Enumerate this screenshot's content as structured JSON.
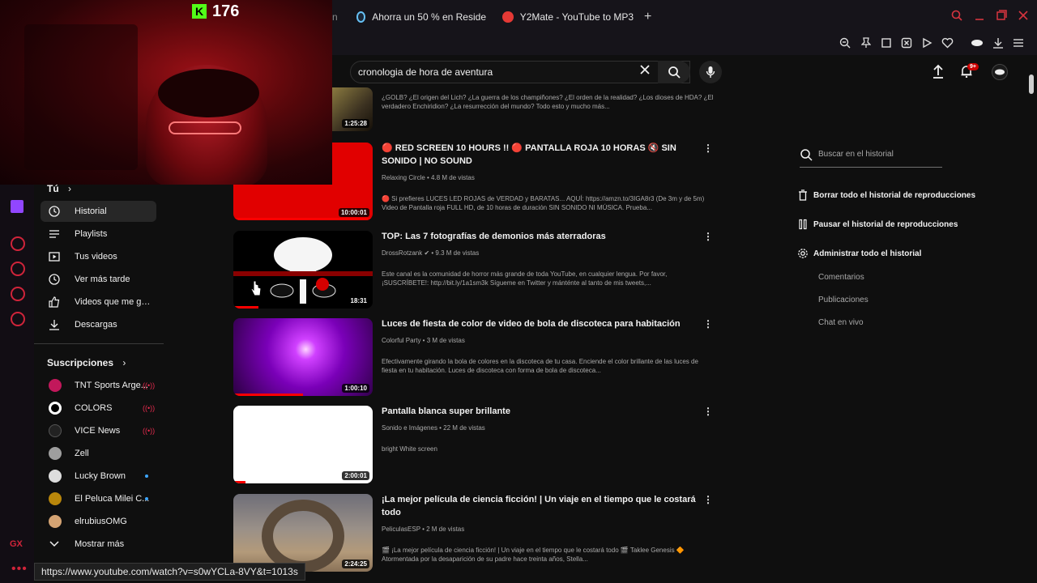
{
  "browser": {
    "tabs": [
      {
        "label": "n",
        "icon": "tab-icon"
      },
      {
        "label": "Ahorra un 50 % en Reside",
        "icon": "steam-icon"
      },
      {
        "label": "Y2Mate - YouTube to MP3",
        "icon": "y2mate-icon"
      }
    ],
    "new_tab": "+",
    "status_url": "https://www.youtube.com/watch?v=s0wYCLa-8VY&t=1013s"
  },
  "stream_overlay": {
    "viewer_count": "176",
    "platform_icon": "kick-icon"
  },
  "youtube": {
    "search": {
      "value": "cronologia de hora de aventura"
    },
    "notification_badge": "9+",
    "guide": {
      "you_header": "Tú",
      "items": [
        {
          "label": "Historial",
          "icon": "history-icon",
          "active": true
        },
        {
          "label": "Playlists",
          "icon": "playlists-icon"
        },
        {
          "label": "Tus videos",
          "icon": "your-videos-icon"
        },
        {
          "label": "Ver más tarde",
          "icon": "watch-later-icon"
        },
        {
          "label": "Videos que me gus...",
          "icon": "liked-icon"
        },
        {
          "label": "Descargas",
          "icon": "download-icon"
        }
      ],
      "subscriptions_header": "Suscripciones",
      "subscriptions": [
        {
          "label": "TNT Sports Arge...",
          "status": "live",
          "color": "#c2185b"
        },
        {
          "label": "COLORS",
          "status": "live",
          "color": "#ffffff"
        },
        {
          "label": "VICE News",
          "status": "live",
          "color": "#222222"
        },
        {
          "label": "Zell",
          "status": "",
          "color": "#9e9e9e"
        },
        {
          "label": "Lucky Brown",
          "status": "new",
          "color": "#cccccc"
        },
        {
          "label": "El Peluca Milei C...",
          "status": "new",
          "color": "#b8860b"
        },
        {
          "label": "elrubiusOMG",
          "status": "",
          "color": "#d4a373"
        }
      ],
      "show_more": "Mostrar más"
    },
    "videos": [
      {
        "title": "",
        "meta": "",
        "description": "¿GOLB? ¿El origen del Lich? ¿La guerra de los champiñones? ¿El orden de la realidad? ¿Los dioses de HDA? ¿El verdadero Enchiridion? ¿La resurrección del mundo? Todo esto y mucho más...",
        "duration": "1:25:28"
      },
      {
        "title": "🔴 RED SCREEN 10 HOURS !! 🔴 PANTALLA ROJA 10 HORAS 🔇 SIN SONIDO | NO SOUND",
        "meta": "Relaxing Circle • 4.8 M de vistas",
        "description": "🔴 Si prefieres LUCES LED ROJAS de VERDAD y BARATAS... AQUÍ: https://amzn.to/3IGA8r3 (De 3m y de 5m) Video de Pantalla roja FULL HD, de 10 horas de duración SIN SONIDO NI MÚSICA. Prueba...",
        "duration": "10:00:01",
        "thumb_color": "#e10000",
        "progress": 1.0
      },
      {
        "title": "TOP: Las 7 fotografías de demonios más aterradoras",
        "meta": "DrossRotzank ✔ • 9.3 M de vistas",
        "description": "Este canal es la comunidad de horror más grande de toda YouTube, en cualquier lengua. Por favor, ¡SUSCRÍBETE!: http://bit.ly/1a1sm3k Sígueme en Twitter y mánténte al tanto de mis tweets,...",
        "duration": "18:31",
        "thumb_color": "#000000",
        "progress": 0.18
      },
      {
        "title": "Luces de fiesta de color de video de bola de discoteca para habitación",
        "meta": "Colorful Party • 3 M de vistas",
        "description": "Efectivamente girando la bola de colores en la discoteca de tu casa. Enciende el color brillante de las luces de fiesta en tu habitación. Luces de discoteca con forma de bola de discoteca...",
        "duration": "1:00:10",
        "thumb_color": "#8e00c8",
        "progress": 0.5
      },
      {
        "title": "Pantalla blanca super brillante",
        "meta": "Sonido e Imágenes • 22 M de vistas",
        "description": "bright White screen",
        "duration": "2:00:01",
        "thumb_color": "#ffffff",
        "progress": 0.09
      },
      {
        "title": "¡La mejor película de ciencia ficción! | Un viaje en el tiempo que le costará todo",
        "meta": "PeliculasESP • 2 M de vistas",
        "description": "🎬 ¡La mejor película de ciencia ficción! | Un viaje en el tiempo que le costará todo 🎬 Taklee Genesis 🔶 Atormentada por la desaparición de su padre hace treinta años, Stella...",
        "duration": "2:24:25",
        "thumb_color": "#8a7f6f",
        "progress": 0
      }
    ],
    "history_panel": {
      "search_placeholder": "Buscar en el historial",
      "actions": [
        {
          "label": "Borrar todo el historial de reproducciones",
          "icon": "trash-icon"
        },
        {
          "label": "Pausar el historial de reproducciones",
          "icon": "pause-icon"
        },
        {
          "label": "Administrar todo el historial",
          "icon": "gear-icon"
        }
      ],
      "sub_items": [
        "Comentarios",
        "Publicaciones",
        "Chat en vivo"
      ]
    }
  },
  "colors": {
    "accent": "#ff0000",
    "gx_accent": "#d0243a",
    "kick_green": "#53fc18"
  }
}
